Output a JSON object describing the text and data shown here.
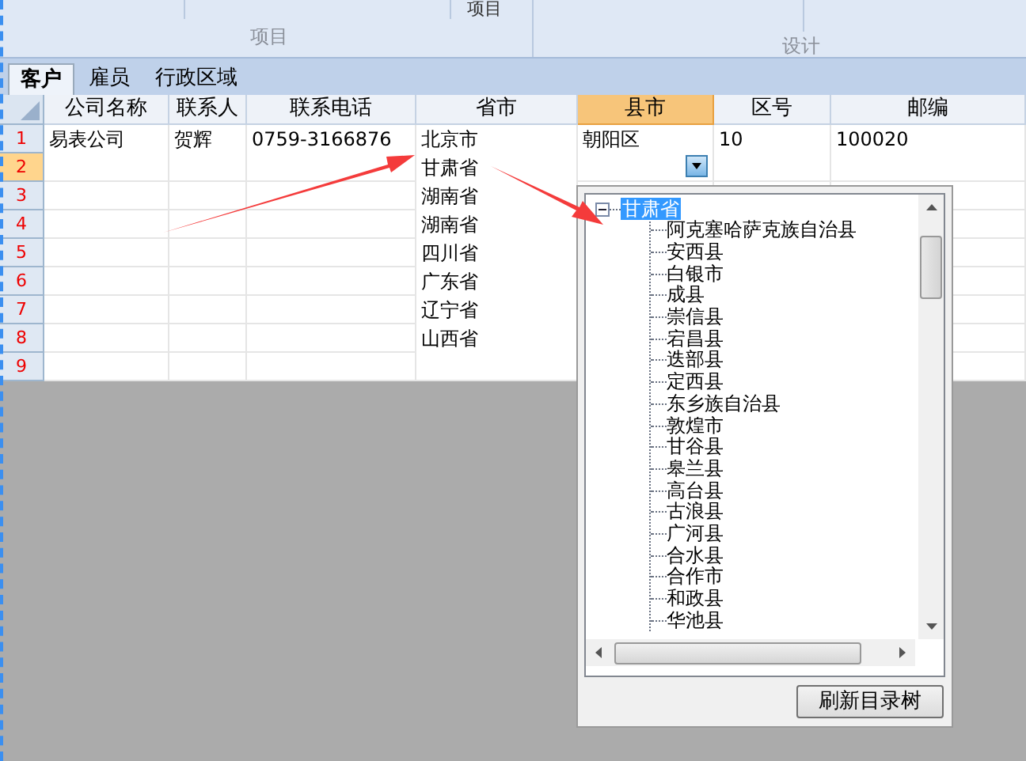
{
  "ribbon": {
    "top_label": "项目",
    "groups": [
      "项目",
      "设计"
    ]
  },
  "tabs": [
    {
      "label": "客户",
      "selected": true
    },
    {
      "label": "雇员",
      "selected": false
    },
    {
      "label": "行政区域",
      "selected": false
    }
  ],
  "table": {
    "columns": [
      {
        "label": "公司名称",
        "selected": false
      },
      {
        "label": "联系人",
        "selected": false
      },
      {
        "label": "联系电话",
        "selected": false
      },
      {
        "label": "省市",
        "selected": false
      },
      {
        "label": "县市",
        "selected": true
      },
      {
        "label": "区号",
        "selected": false
      },
      {
        "label": "邮编",
        "selected": false
      }
    ],
    "rows": [
      {
        "number": "1",
        "selected": false,
        "cells": [
          "易表公司",
          "贺辉",
          "0759-3166876",
          "北京市",
          "朝阳区",
          "10",
          "100020"
        ]
      },
      {
        "number": "2",
        "selected": true,
        "cells": [
          "",
          "",
          "",
          "甘肃省",
          "",
          "",
          ""
        ]
      },
      {
        "number": "3",
        "selected": false,
        "cells": [
          "",
          "",
          "",
          "湖南省",
          "",
          "",
          ""
        ]
      },
      {
        "number": "4",
        "selected": false,
        "cells": [
          "",
          "",
          "",
          "湖南省",
          "",
          "",
          ""
        ]
      },
      {
        "number": "5",
        "selected": false,
        "cells": [
          "",
          "",
          "",
          "四川省",
          "",
          "",
          ""
        ]
      },
      {
        "number": "6",
        "selected": false,
        "cells": [
          "",
          "",
          "",
          "广东省",
          "",
          "",
          ""
        ]
      },
      {
        "number": "7",
        "selected": false,
        "cells": [
          "",
          "",
          "",
          "辽宁省",
          "",
          "",
          ""
        ]
      },
      {
        "number": "8",
        "selected": false,
        "cells": [
          "",
          "",
          "",
          "山西省",
          "",
          "",
          ""
        ]
      },
      {
        "number": "9",
        "selected": false,
        "cells": [
          "",
          "",
          "",
          "",
          "",
          "",
          ""
        ]
      }
    ]
  },
  "dropdown": {
    "tree": [
      {
        "label": "甘肃省",
        "selected": true,
        "expanded": true,
        "children": [
          {
            "label": "阿克塞哈萨克族自治县"
          },
          {
            "label": "安西县"
          },
          {
            "label": "白银市"
          },
          {
            "label": "成县"
          },
          {
            "label": "崇信县"
          },
          {
            "label": "宕昌县"
          },
          {
            "label": "迭部县"
          },
          {
            "label": "定西县"
          },
          {
            "label": "东乡族自治县"
          },
          {
            "label": "敦煌市"
          },
          {
            "label": "甘谷县"
          },
          {
            "label": "皋兰县"
          },
          {
            "label": "高台县"
          },
          {
            "label": "古浪县"
          },
          {
            "label": "广河县"
          },
          {
            "label": "合水县"
          },
          {
            "label": "合作市"
          },
          {
            "label": "和政县"
          },
          {
            "label": "华池县"
          }
        ]
      }
    ],
    "button": "刷新目录树"
  }
}
